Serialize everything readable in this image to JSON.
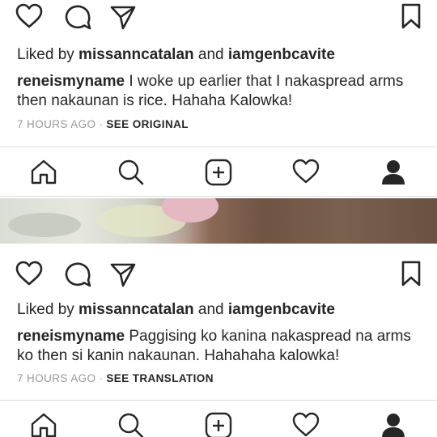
{
  "posts": [
    {
      "likes": {
        "prefix": "Liked by ",
        "user1": "missanncatalan",
        "joiner": " and ",
        "user2": "iamgenbcavite"
      },
      "caption": {
        "username": "reneismyname",
        "text": "I woke up earlier that I nakaspread arms then nakaunan is rice. Hahaha Kalowka!"
      },
      "meta": {
        "time": "7 HOURS AGO",
        "separator": "·",
        "link": "SEE ORIGINAL"
      }
    },
    {
      "likes": {
        "prefix": "Liked by ",
        "user1": "missanncatalan",
        "joiner": " and ",
        "user2": "iamgenbcavite"
      },
      "caption": {
        "username": "reneismyname",
        "text": "Paggising ko kanina nakaspread na arms ko then si kanin nakaunan. Hahahaha kalowka!"
      },
      "meta": {
        "time": "7 HOURS AGO",
        "separator": "·",
        "link": "SEE TRANSLATION"
      }
    }
  ],
  "icons": {
    "post_actions": [
      "heart-icon",
      "comment-icon",
      "share-icon",
      "bookmark-icon"
    ],
    "nav": [
      "home-icon",
      "search-icon",
      "add-post-icon",
      "activity-heart-icon",
      "profile-icon"
    ]
  },
  "colors": {
    "text": "#262626",
    "muted": "#999999",
    "divider": "#dbdbdb",
    "background": "#ffffff"
  }
}
